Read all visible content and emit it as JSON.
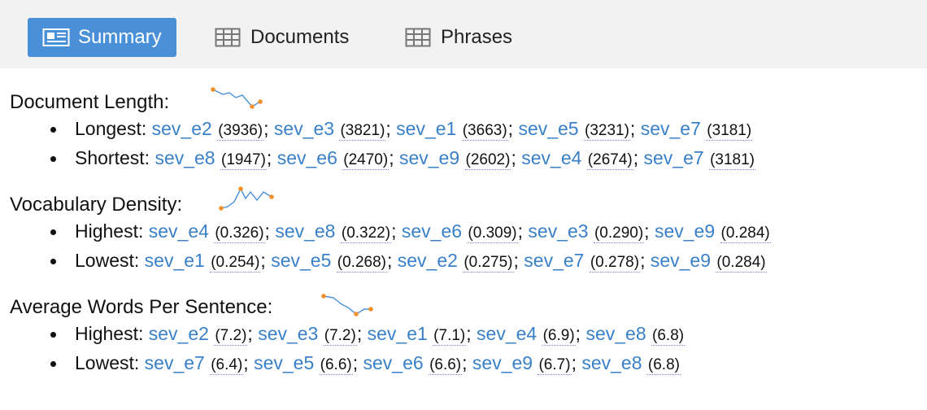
{
  "tabs": [
    {
      "label": "Summary",
      "icon": "newspaper-icon",
      "active": true
    },
    {
      "label": "Documents",
      "icon": "table-icon",
      "active": false
    },
    {
      "label": "Phrases",
      "icon": "table-icon",
      "active": false
    }
  ],
  "sections": [
    {
      "title": "Document Length:",
      "rows": [
        {
          "label": "Longest:",
          "items": [
            [
              "sev_e2",
              "3936"
            ],
            [
              "sev_e3",
              "3821"
            ],
            [
              "sev_e1",
              "3663"
            ],
            [
              "sev_e5",
              "3231"
            ],
            [
              "sev_e7",
              "3181"
            ]
          ]
        },
        {
          "label": "Shortest:",
          "items": [
            [
              "sev_e8",
              "1947"
            ],
            [
              "sev_e6",
              "2470"
            ],
            [
              "sev_e9",
              "2602"
            ],
            [
              "sev_e4",
              "2674"
            ],
            [
              "sev_e7",
              "3181"
            ]
          ]
        }
      ]
    },
    {
      "title": "Vocabulary Density:",
      "rows": [
        {
          "label": "Highest:",
          "items": [
            [
              "sev_e4",
              "0.326"
            ],
            [
              "sev_e8",
              "0.322"
            ],
            [
              "sev_e6",
              "0.309"
            ],
            [
              "sev_e3",
              "0.290"
            ],
            [
              "sev_e9",
              "0.284"
            ]
          ]
        },
        {
          "label": "Lowest:",
          "items": [
            [
              "sev_e1",
              "0.254"
            ],
            [
              "sev_e5",
              "0.268"
            ],
            [
              "sev_e2",
              "0.275"
            ],
            [
              "sev_e7",
              "0.278"
            ],
            [
              "sev_e9",
              "0.284"
            ]
          ]
        }
      ]
    },
    {
      "title": "Average Words Per Sentence:",
      "rows": [
        {
          "label": "Highest:",
          "items": [
            [
              "sev_e2",
              "7.2"
            ],
            [
              "sev_e3",
              "7.2"
            ],
            [
              "sev_e1",
              "7.1"
            ],
            [
              "sev_e4",
              "6.9"
            ],
            [
              "sev_e8",
              "6.8"
            ]
          ]
        },
        {
          "label": "Lowest:",
          "items": [
            [
              "sev_e7",
              "6.4"
            ],
            [
              "sev_e5",
              "6.6"
            ],
            [
              "sev_e6",
              "6.6"
            ],
            [
              "sev_e9",
              "6.7"
            ],
            [
              "sev_e8",
              "6.8"
            ]
          ]
        }
      ]
    }
  ],
  "colors": {
    "accent": "#4a90d9",
    "link": "#3a80c8",
    "spark_line": "#4a90d9",
    "spark_point": "#f0902a"
  }
}
